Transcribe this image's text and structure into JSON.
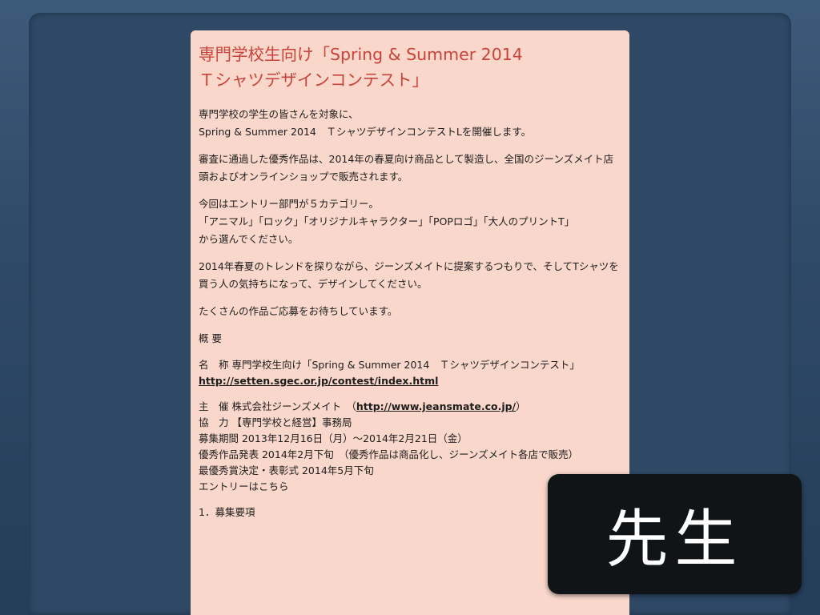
{
  "document": {
    "title": "専門学校生向け「Spring & Summer 2014\nＴシャツデザインコンテスト」",
    "p1": "専門学校の学生の皆さんを対象に、\nSpring & Summer 2014　ＴシャツデザインコンテストLを開催します。",
    "p2": "審査に通過した優秀作品は、2014年の春夏向け商品として製造し、全国のジーンズメイト店頭およびオンラインショップで販売されます。",
    "p3": "今回はエントリー部門が５カテゴリー。\n「アニマル」「ロック」「オリジナルキャラクター」「POPロゴ」「大人のプリントT」\nから選んでください。",
    "p4": "2014年春夏のトレンドを探りながら、ジーンズメイトに提案するつもりで、そしてTシャツを買う人の気持ちになって、デザインしてください。",
    "p5": "たくさんの作品ご応募をお待ちしています。",
    "overview_heading": "概 要",
    "name_row": "名　称 専門学校生向け「Spring & Summer 2014　Ｔシャツデザインコンテスト」",
    "contest_url": "http://setten.sgec.or.jp/contest/index.html",
    "organizer_prefix": "主　催 株式会社ジーンズメイト　（",
    "organizer_url": "http://www.jeansmate.co.jp/",
    "organizer_suffix": "）",
    "cooperation": "協　力 【専門学校と経営】事務局",
    "period": "募集期間 2013年12月16日（月）～2014年2月21日（金）",
    "announce": "優秀作品発表 2014年2月下旬　（優秀作品は商品化し、ジーンズメイト各店で販売）",
    "final": "最優秀賞決定・表彰式 2014年5月下旬",
    "entry": "エントリーはこちら",
    "section1": "1．募集要項"
  },
  "overlay": {
    "label": "先生"
  },
  "colors": {
    "title": "#c9433a",
    "document_bg": "#f9d7cb",
    "slide_bg": "#2e4866"
  }
}
